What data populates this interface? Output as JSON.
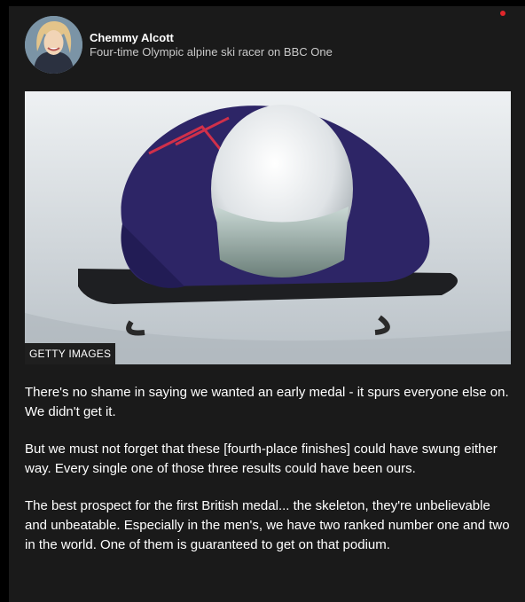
{
  "colors": {
    "background": "#000000",
    "card": "#1a1a1a",
    "text": "#ffffff",
    "secondary_text": "#c9c9c9",
    "live_dot": "#e0262b"
  },
  "header": {
    "author": "Chemmy Alcott",
    "role": "Four-time Olympic alpine ski racer on BBC One"
  },
  "photo": {
    "credit": "GETTY IMAGES"
  },
  "paragraphs": [
    "There's no shame in saying we wanted an early medal - it spurs everyone else on. We didn't get it.",
    "But we must not forget that these [fourth-place finishes] could have swung either way. Every single one of those three results could have been ours.",
    "The best prospect for the first British medal... the skeleton, they're unbelievable and unbeatable. Especially in the men's, we have two ranked number one and two in the world. One of them is guaranteed to get on that podium."
  ]
}
